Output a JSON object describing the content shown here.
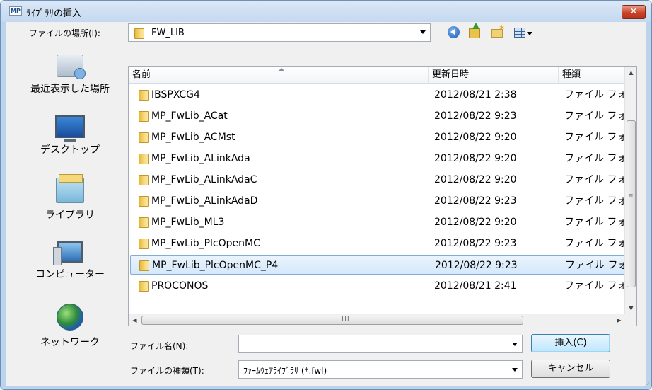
{
  "window": {
    "title": "ﾗｲﾌﾞﾗﾘの挿入",
    "app_icon_text": "MP",
    "close_label": "✕"
  },
  "lookin": {
    "label": "ファイルの場所(I):",
    "value": "FW_LIB"
  },
  "toolbar": {
    "back_icon": "back-icon",
    "up_icon": "up-folder-icon",
    "newfolder_icon": "new-folder-icon",
    "view_icon": "view-menu-icon"
  },
  "places": [
    {
      "label": "最近表示した場所",
      "icon": "recent-places-icon"
    },
    {
      "label": "デスクトップ",
      "icon": "desktop-icon"
    },
    {
      "label": "ライブラリ",
      "icon": "libraries-icon"
    },
    {
      "label": "コンピューター",
      "icon": "computer-icon"
    },
    {
      "label": "ネットワーク",
      "icon": "network-icon"
    }
  ],
  "columns": {
    "name": "名前",
    "date": "更新日時",
    "type": "種類"
  },
  "files": [
    {
      "name": "IBSPXCG4",
      "date": "2012/08/21 2:38",
      "type": "ファイル フォルダー"
    },
    {
      "name": "MP_FwLib_ACat",
      "date": "2012/08/22 9:23",
      "type": "ファイル フォルダー"
    },
    {
      "name": "MP_FwLib_ACMst",
      "date": "2012/08/22 9:20",
      "type": "ファイル フォルダー"
    },
    {
      "name": "MP_FwLib_ALinkAda",
      "date": "2012/08/22 9:20",
      "type": "ファイル フォルダー"
    },
    {
      "name": "MP_FwLib_ALinkAdaC",
      "date": "2012/08/22 9:20",
      "type": "ファイル フォルダー"
    },
    {
      "name": "MP_FwLib_ALinkAdaD",
      "date": "2012/08/22 9:23",
      "type": "ファイル フォルダー"
    },
    {
      "name": "MP_FwLib_ML3",
      "date": "2012/08/22 9:20",
      "type": "ファイル フォルダー"
    },
    {
      "name": "MP_FwLib_PlcOpenMC",
      "date": "2012/08/22 9:23",
      "type": "ファイル フォルダー"
    },
    {
      "name": "MP_FwLib_PlcOpenMC_P4",
      "date": "2012/08/22 9:23",
      "type": "ファイル フォルダー",
      "selected": true
    },
    {
      "name": "PROCONOS",
      "date": "2012/08/21 2:41",
      "type": "ファイル フォルダー"
    }
  ],
  "scroll": {
    "vertical_grip": "≡",
    "horizontal_grip": "III"
  },
  "filename": {
    "label": "ファイル名(N):",
    "value": ""
  },
  "filetype": {
    "label": "ファイルの種類(T):",
    "value": "ﾌｧｰﾑｳｪｱﾗｲﾌﾞﾗﾘ (*.fwl)"
  },
  "buttons": {
    "insert": "挿入(C)",
    "cancel": "キャンセル"
  },
  "colors": {
    "frame": "#bcd3ec",
    "selection": "#d5e8fb",
    "close": "#c9452c"
  }
}
